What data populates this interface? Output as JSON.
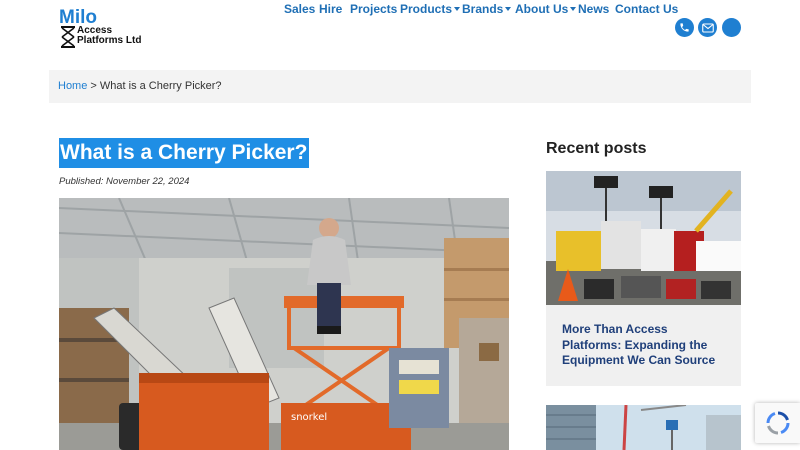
{
  "brand": {
    "name_top": "Milo",
    "name_line1": "Access",
    "name_line2": "Platforms Ltd"
  },
  "nav": {
    "items": [
      {
        "label": "Sales",
        "dropdown": false
      },
      {
        "label": "Hire",
        "dropdown": false
      },
      {
        "label": "Projects",
        "dropdown": false
      },
      {
        "label": "Products",
        "dropdown": true
      },
      {
        "label": "Brands",
        "dropdown": true
      },
      {
        "label": "About Us",
        "dropdown": true
      },
      {
        "label": "News",
        "dropdown": false
      },
      {
        "label": "Contact Us",
        "dropdown": false
      }
    ],
    "icons": [
      "phone-icon",
      "mail-icon",
      "extra-icon"
    ]
  },
  "breadcrumb": {
    "home": "Home",
    "separator": " > ",
    "current": "What is a Cherry Picker?"
  },
  "article": {
    "title": "What is a Cherry Picker?",
    "published": "Published: November 22, 2024",
    "hero_brand_text": "snorkel"
  },
  "sidebar": {
    "heading": "Recent posts",
    "posts": [
      {
        "title": "More Than Access Platforms: Expanding the Equipment We Can Source"
      }
    ]
  },
  "colors": {
    "brand_blue": "#1f7fd1",
    "nav_text": "#1f6fb5",
    "title_highlight": "#1f8ee5",
    "breadcrumb_bg": "#f3f3f3",
    "card_bg": "#f0f0f0",
    "post_title": "#1f3f7a"
  }
}
